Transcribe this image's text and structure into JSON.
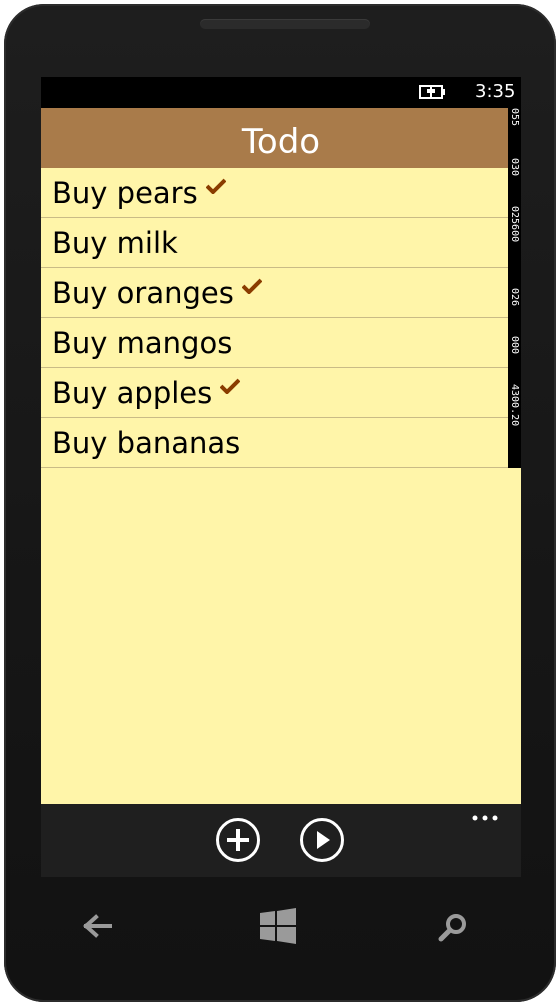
{
  "status": {
    "time": "3:35",
    "battery_icon": "battery-charging-icon"
  },
  "app": {
    "title": "Todo"
  },
  "todos": [
    {
      "label": "Buy pears",
      "done": true
    },
    {
      "label": "Buy milk",
      "done": false
    },
    {
      "label": "Buy oranges",
      "done": true
    },
    {
      "label": "Buy mangos",
      "done": false
    },
    {
      "label": "Buy apples",
      "done": true
    },
    {
      "label": "Buy bananas",
      "done": false
    }
  ],
  "frame_counters": [
    "055",
    "030",
    "025600",
    "026",
    "000",
    "4300.20"
  ],
  "appbar": {
    "buttons": [
      {
        "icon": "add-icon"
      },
      {
        "icon": "play-icon"
      }
    ],
    "more_icon": "ellipsis-icon"
  },
  "hardware_buttons": [
    "back-icon",
    "windows-icon",
    "search-icon"
  ],
  "colors": {
    "header": "#a97b4a",
    "background": "#fff5a9",
    "checkmark": "#8a3c00",
    "appbar": "#1f1f1f"
  }
}
